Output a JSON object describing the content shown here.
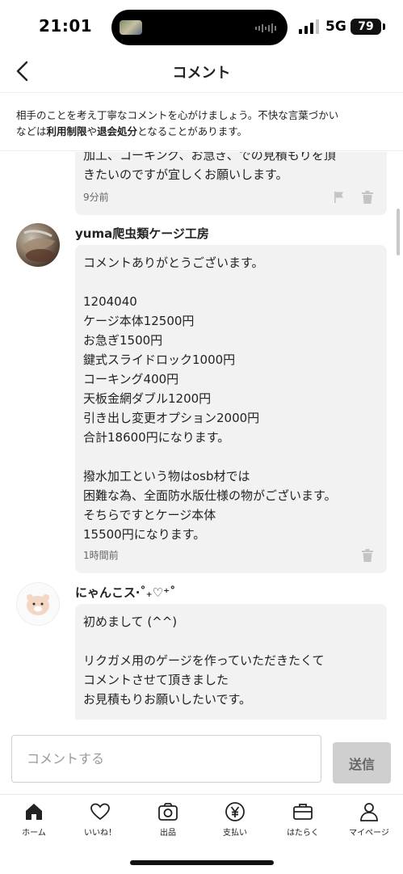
{
  "status_bar": {
    "time": "21:01",
    "network": "5G",
    "battery": "79"
  },
  "header": {
    "title": "コメント"
  },
  "notice": {
    "text_1": "相手のことを考え丁寧なコメントを心がけましょう。不快な言葉づかい",
    "text_2a": "などは",
    "text_2b": "利用制限",
    "text_2c": "や",
    "text_2d": "退会処分",
    "text_2e": "となることがあります。"
  },
  "comments": [
    {
      "text": "加工、コーキング、お急ぎ、での見積もりを頂\nきたいのですが宜しくお願いします。",
      "time": "9分前"
    },
    {
      "username": "yuma爬虫類ケージ工房",
      "text": "コメントありがとうございます。\n\n1204040\nケージ本体12500円\nお急ぎ1500円\n鍵式スライドロック1000円\nコーキング400円\n天板金網ダブル1200円\n引き出し変更オプション2000円\n合計18600円になります。\n\n撥水加工という物はosb材では\n困難な為、全面防水版仕様の物がございます。\nそちらですとケージ本体\n15500円になります。",
      "time": "1時間前"
    },
    {
      "username": "にゃんこス‧˚₊♡⁺˚",
      "text": "初めまして (^^)\n\nリクガメ用のゲージを作っていただきたくて\nコメントさせて頂きました\nお見積もりお願いしたいです。"
    }
  ],
  "composer": {
    "placeholder": "コメントする",
    "send_label": "送信"
  },
  "tabbar": {
    "items": [
      {
        "label": "ホーム",
        "icon": "home-icon"
      },
      {
        "label": "いいね！",
        "icon": "heart-icon"
      },
      {
        "label": "出品",
        "icon": "camera-icon"
      },
      {
        "label": "支払い",
        "icon": "yen-icon"
      },
      {
        "label": "はたらく",
        "icon": "briefcase-icon"
      },
      {
        "label": "マイページ",
        "icon": "person-icon"
      }
    ]
  }
}
